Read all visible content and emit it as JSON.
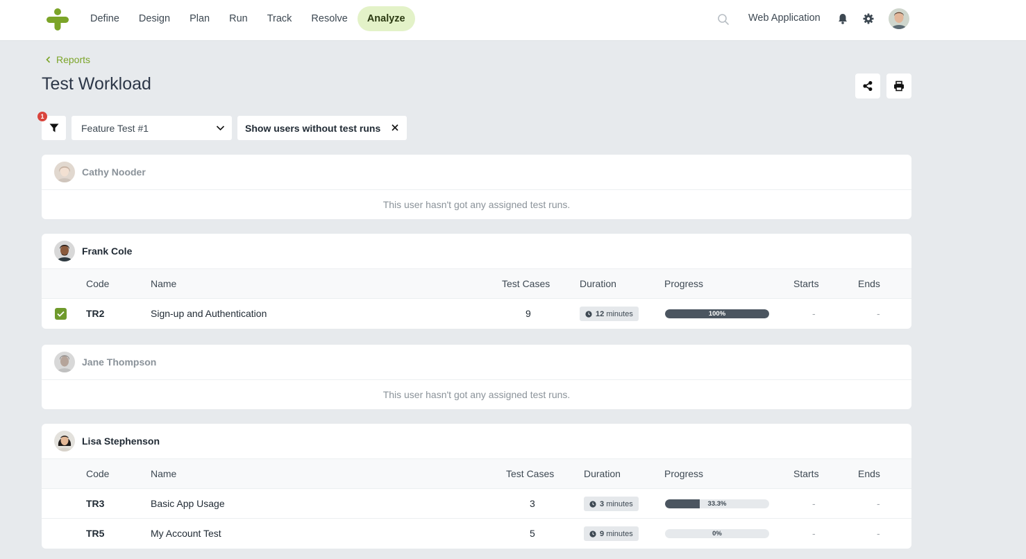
{
  "nav": {
    "items": [
      "Define",
      "Design",
      "Plan",
      "Run",
      "Track",
      "Resolve",
      "Analyze"
    ],
    "active": "Analyze",
    "project": "Web Application"
  },
  "breadcrumb": "Reports",
  "title": "Test Workload",
  "filters": {
    "badge_count": "1",
    "selected_run": "Feature Test #1",
    "chip_label": "Show users without test runs"
  },
  "columns": {
    "code": "Code",
    "name": "Name",
    "test_cases": "Test Cases",
    "duration": "Duration",
    "progress": "Progress",
    "starts": "Starts",
    "ends": "Ends"
  },
  "empty_message": "This user hasn't got any assigned test runs.",
  "users": [
    {
      "name": "Cathy Nooder",
      "runs": []
    },
    {
      "name": "Frank Cole",
      "runs": [
        {
          "code": "TR2",
          "name": "Sign-up and Authentication",
          "test_cases": "9",
          "duration_value": "12",
          "duration_unit": "minutes",
          "progress": 100,
          "progress_label": "100%",
          "starts": "-",
          "ends": "-",
          "checked": true
        }
      ]
    },
    {
      "name": "Jane Thompson",
      "runs": []
    },
    {
      "name": "Lisa Stephenson",
      "runs": [
        {
          "code": "TR3",
          "name": "Basic App Usage",
          "test_cases": "3",
          "duration_value": "3",
          "duration_unit": "minutes",
          "progress": 33.3,
          "progress_label": "33.3%",
          "starts": "-",
          "ends": "-",
          "checked": false
        },
        {
          "code": "TR5",
          "name": "My Account Test",
          "test_cases": "5",
          "duration_value": "9",
          "duration_unit": "minutes",
          "progress": 0,
          "progress_label": "0%",
          "starts": "-",
          "ends": "-",
          "checked": false
        }
      ]
    }
  ],
  "colors": {
    "accent": "#7ba428",
    "active_nav_bg": "#e3f2c8",
    "progress_fill": "#4b5560",
    "badge": "#d9443c"
  }
}
